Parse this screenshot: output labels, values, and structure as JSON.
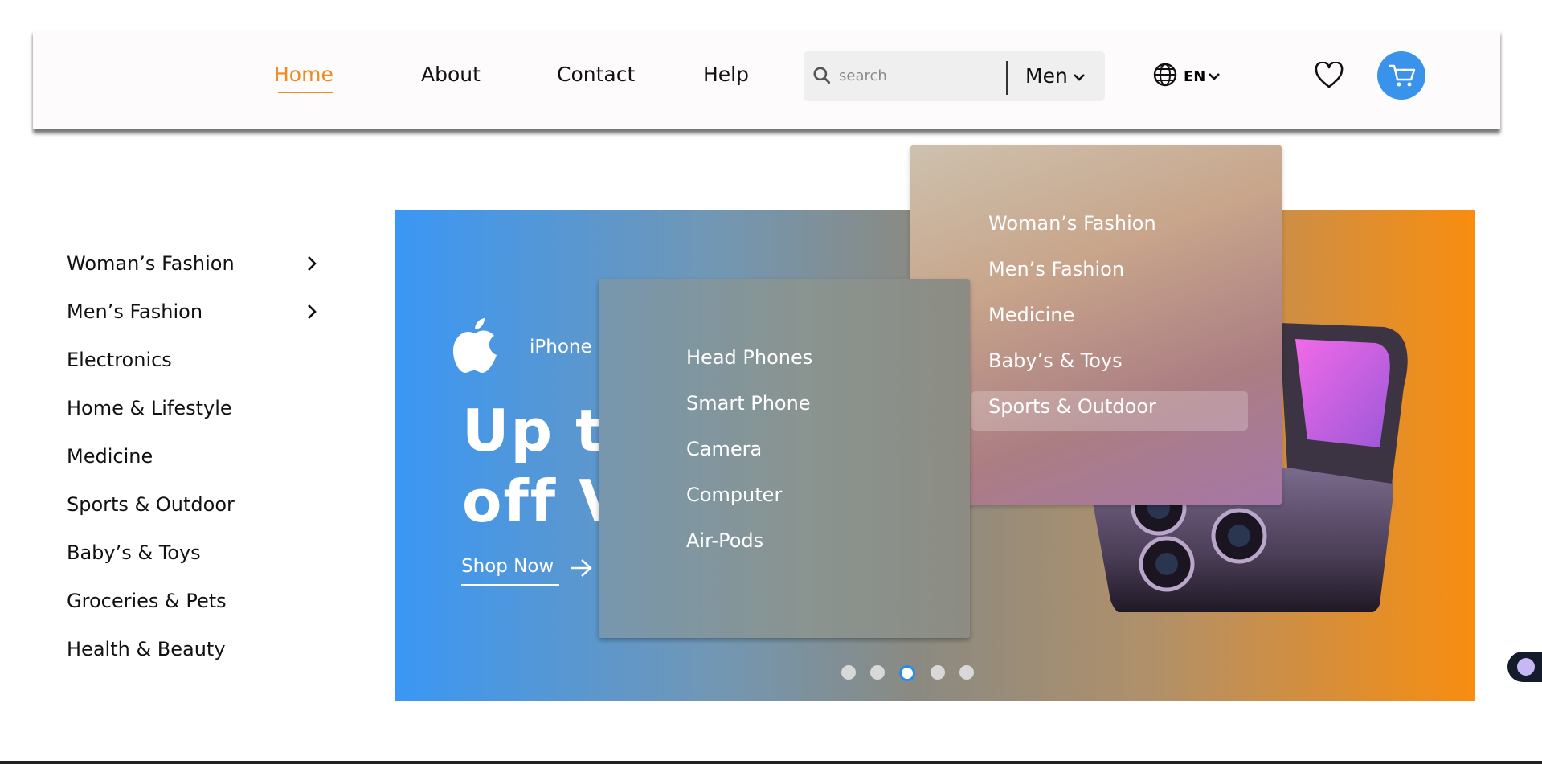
{
  "header": {
    "nav": [
      "Home",
      "About",
      "Contact",
      "Help"
    ],
    "search_placeholder": "search",
    "search_category": "Men",
    "language": "EN"
  },
  "sidebar": {
    "items": [
      {
        "label": "Woman’s Fashion",
        "has_submenu": true
      },
      {
        "label": "Men’s Fashion",
        "has_submenu": true
      },
      {
        "label": "Electronics"
      },
      {
        "label": "Home & Lifestyle"
      },
      {
        "label": "Medicine"
      },
      {
        "label": "Sports & Outdoor"
      },
      {
        "label": "Baby’s & Toys"
      },
      {
        "label": "Groceries & Pets"
      },
      {
        "label": "Health & Beauty"
      }
    ]
  },
  "banner": {
    "subtitle": "iPhone",
    "headline_line1": "Up to",
    "headline_line2": "off V",
    "cta": "Shop Now",
    "slides_total": 5,
    "active_slide": 3
  },
  "dropdown_main": {
    "items": [
      "Woman’s Fashion",
      "Men’s Fashion",
      "Medicine",
      "Baby’s & Toys",
      "Sports & Outdoor"
    ],
    "highlighted": "Sports & Outdoor"
  },
  "dropdown_sub": {
    "items": [
      "Head Phones",
      "Smart Phone",
      "Camera",
      "Computer",
      "Air-Pods"
    ]
  },
  "colors": {
    "accent": "#f08a1c",
    "primary_blue": "#3a93ea"
  },
  "icons": [
    "search-icon",
    "chevron-down-icon",
    "globe-icon",
    "heart-icon",
    "cart-icon",
    "chevron-right-icon",
    "apple-logo-icon",
    "arrow-right-icon",
    "chatbot-icon"
  ]
}
